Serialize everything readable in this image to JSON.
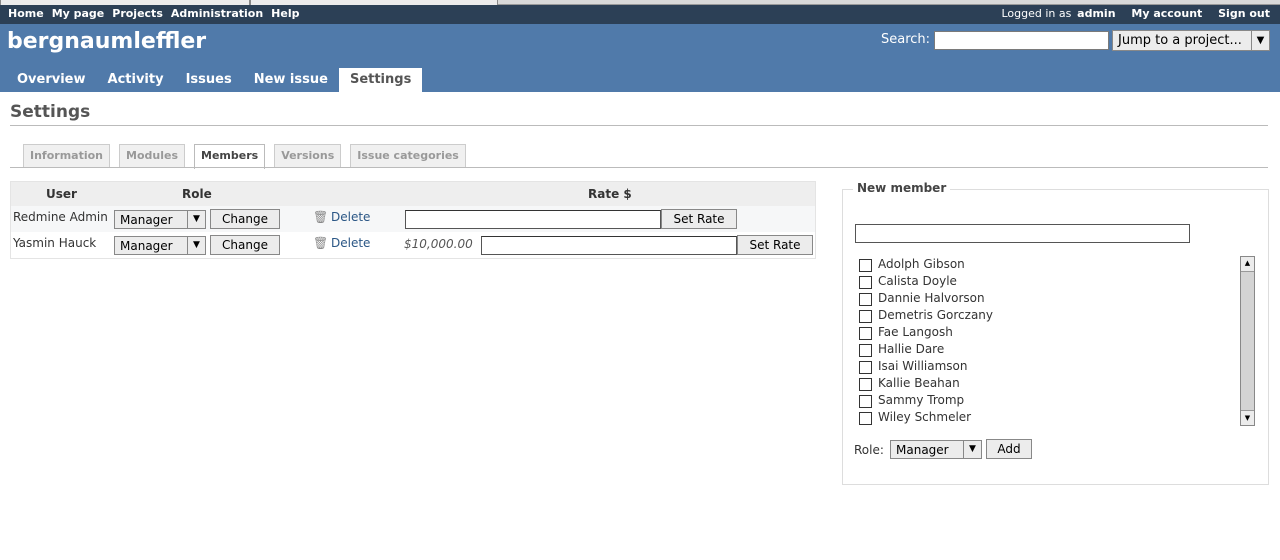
{
  "top_menu": {
    "links": [
      "Home",
      "My page",
      "Projects",
      "Administration",
      "Help"
    ],
    "logged_in_prefix": "Logged in as",
    "logged_in_user": "admin",
    "my_account": "My account",
    "sign_out": "Sign out"
  },
  "header": {
    "project_title": "bergnaumleffler",
    "search_label": "Search:",
    "search_value": "",
    "jump_label": "Jump to a project..."
  },
  "main_menu": [
    "Overview",
    "Activity",
    "Issues",
    "New issue",
    "Settings"
  ],
  "page": {
    "title": "Settings"
  },
  "tabs": [
    "Information",
    "Modules",
    "Members",
    "Versions",
    "Issue categories"
  ],
  "members_table": {
    "headers": {
      "user": "User",
      "role": "Role",
      "rate": "Rate $"
    },
    "rows": [
      {
        "user": "Redmine Admin",
        "role": "Manager",
        "change": "Change",
        "delete": "Delete",
        "rate": "",
        "set_rate": "Set Rate"
      },
      {
        "user": "Yasmin Hauck",
        "role": "Manager",
        "change": "Change",
        "delete": "Delete",
        "rate": "$10,000.00",
        "set_rate": "Set Rate"
      }
    ]
  },
  "new_member": {
    "legend": "New member",
    "search_value": "",
    "principals": [
      "Adolph Gibson",
      "Calista Doyle",
      "Dannie Halvorson",
      "Demetris Gorczany",
      "Fae Langosh",
      "Hallie Dare",
      "Isai Williamson",
      "Kallie Beahan",
      "Sammy Tromp",
      "Wiley Schmeler"
    ],
    "role_label": "Role:",
    "role_value": "Manager",
    "add_label": "Add"
  }
}
